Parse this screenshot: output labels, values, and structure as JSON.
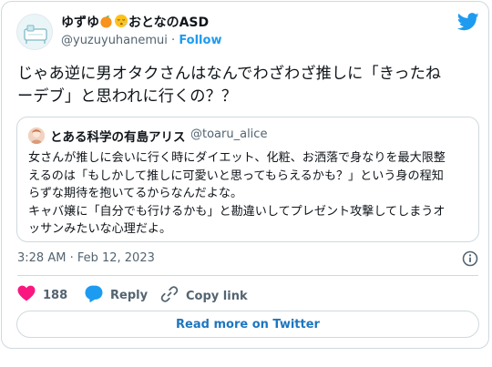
{
  "author": {
    "display_name": "ゆずゆ🍊😮‍💨おとなのASD",
    "name_prefix": "ゆずゆ",
    "name_suffix": "おとなのASD",
    "emoji_1": "orange-emoji",
    "emoji_2": "exhaling-face-emoji",
    "handle": "@yuzuyuhanemui",
    "separator": "·",
    "follow_label": "Follow"
  },
  "tweet": {
    "text": "じゃあ逆に男オタクさんはなんでわざわざ推しに「きったねーデブ」と思われに行くの？？",
    "text_line1": "じゃあ逆に男オタクさんはなんでわざわざ推しに「きったね",
    "text_line2": "ーデブ」と思われに行くの？？"
  },
  "quote": {
    "name": "とある科学の有島アリス",
    "handle": "@toaru_alice",
    "text_lines": [
      "女さんが推しに会いに行く時にダイエット、化粧、お洒落で身なりを最大限整",
      "えるのは「もしかして推しに可愛いと思ってもらえるかも？」という身の程知",
      "らずな期待を抱いてるからなんだよな。",
      "キャバ嬢に「自分でも行けるかも」と勘違いしてプレゼント攻撃してしまうオ",
      "ッサンみたいな心理だよ。"
    ]
  },
  "timestamp": "3:28 AM · Feb 12, 2023",
  "actions": {
    "like_count": "188",
    "reply_label": "Reply",
    "copy_link_label": "Copy link"
  },
  "read_more_label": "Read more on Twitter",
  "colors": {
    "accent": "#1d9bf0",
    "like": "#f91880",
    "muted": "#536471",
    "border": "#cfd9de"
  },
  "icons": [
    "twitter-bird-icon",
    "info-icon",
    "heart-icon",
    "reply-bubble-icon",
    "link-icon"
  ]
}
